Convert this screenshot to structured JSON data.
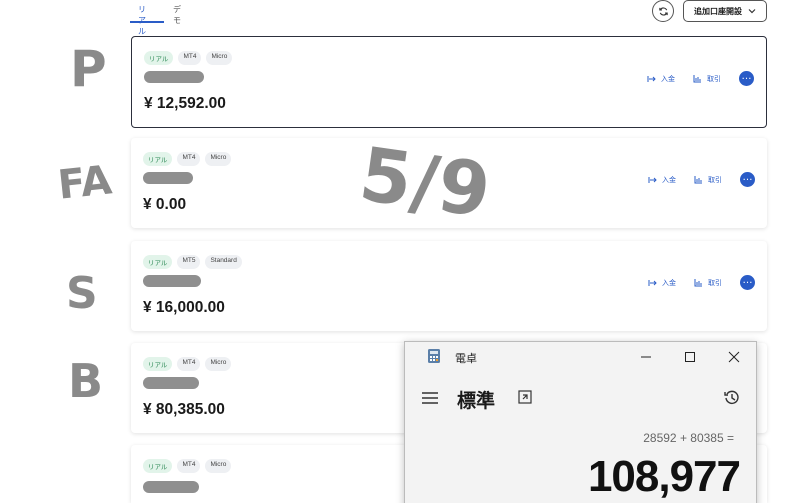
{
  "tabs": [
    "リアル",
    "デモ"
  ],
  "header": {
    "add_account_label": "追加口座開設"
  },
  "accounts": [
    {
      "badges": [
        "リアル",
        "MT4",
        "Micro"
      ],
      "balance": "¥ 12,592.00",
      "deposit": "入金",
      "trade": "取引"
    },
    {
      "badges": [
        "リアル",
        "MT4",
        "Micro"
      ],
      "balance": "¥ 0.00",
      "deposit": "入金",
      "trade": "取引"
    },
    {
      "badges": [
        "リアル",
        "MT5",
        "Standard"
      ],
      "balance": "¥ 16,000.00",
      "deposit": "入金",
      "trade": "取引"
    },
    {
      "badges": [
        "リアル",
        "MT4",
        "Micro"
      ],
      "balance": "¥ 80,385.00"
    },
    {
      "badges": [
        "リアル",
        "MT4",
        "Micro"
      ]
    }
  ],
  "annotations": {
    "p": "P",
    "fa": "FA",
    "s": "S",
    "b": "B",
    "date": "5/9"
  },
  "calculator": {
    "title": "電卓",
    "mode": "標準",
    "expression": "28592 + 80385 =",
    "result": "108,977"
  },
  "icons": [
    "refresh-icon",
    "chevron-down-icon",
    "deposit-icon",
    "trade-chart-icon",
    "more-icon",
    "menu-icon",
    "keep-on-top-icon",
    "history-icon",
    "minimize-icon",
    "maximize-icon",
    "close-icon",
    "calculator-app-icon"
  ],
  "colors": {
    "accent": "#2a5cc7",
    "green_badge_text": "#2c8a55"
  }
}
